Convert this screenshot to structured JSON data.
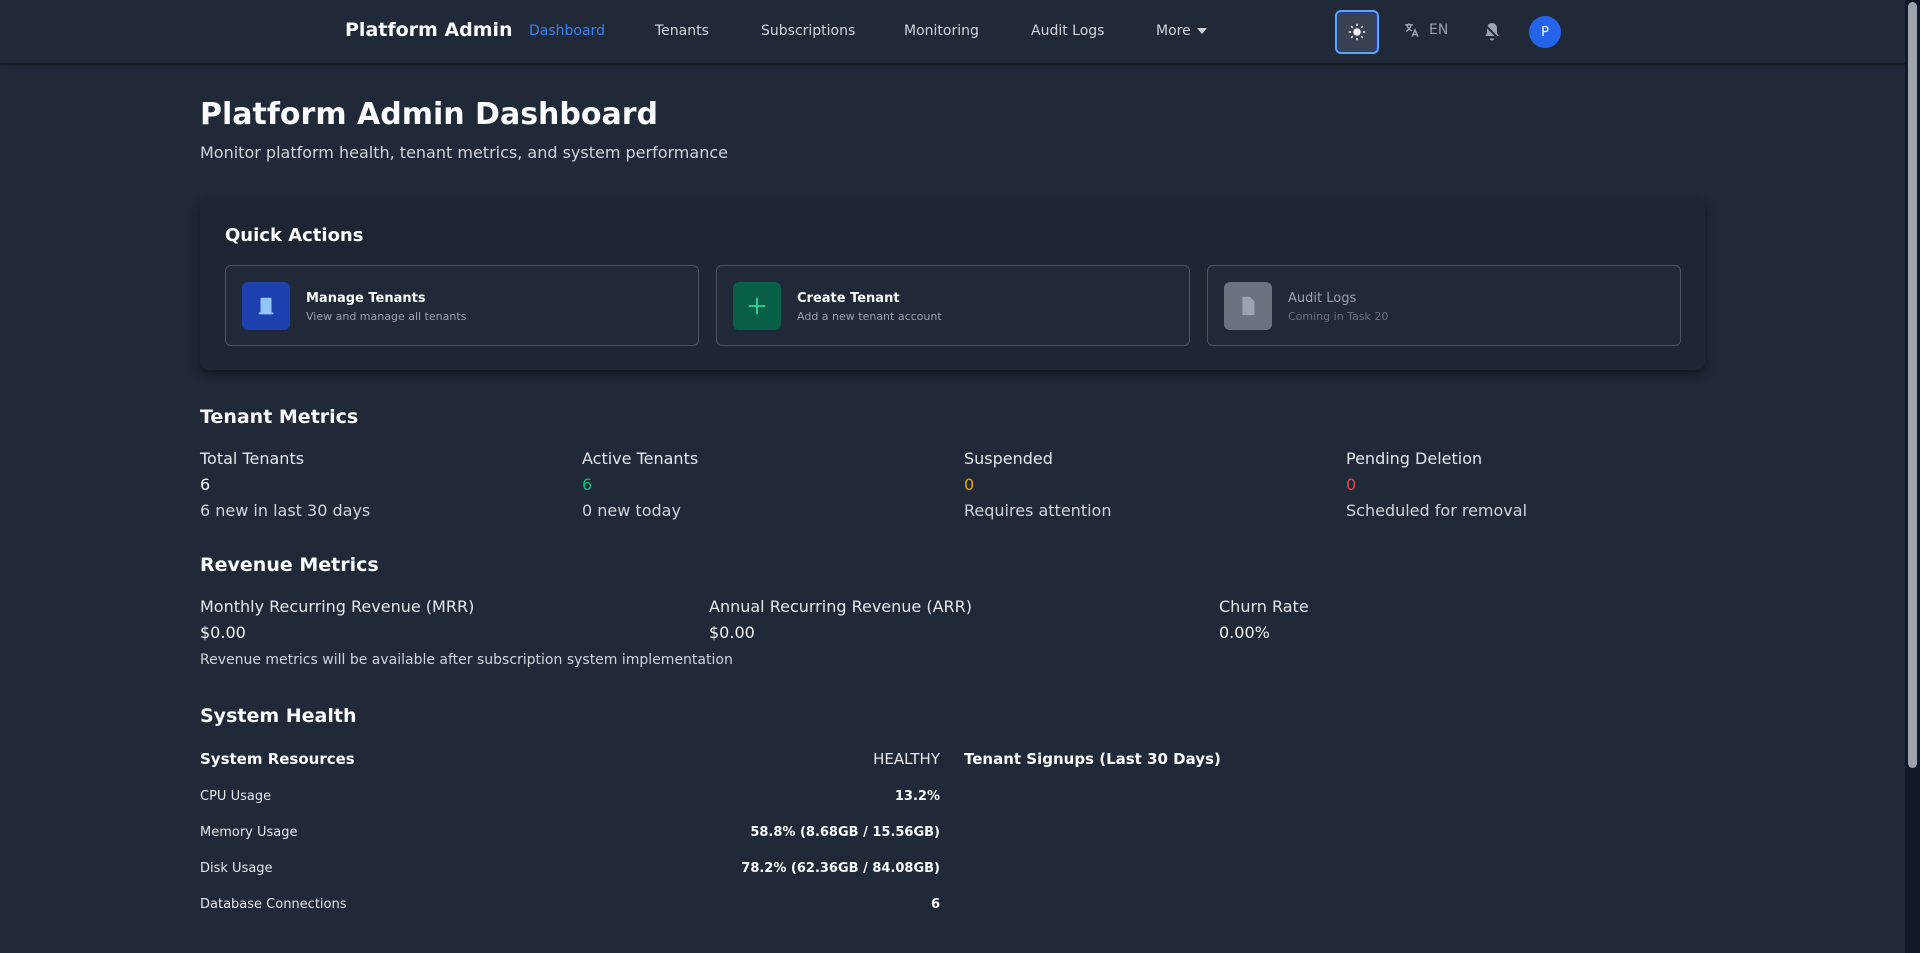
{
  "nav": {
    "brand": "Platform Admin",
    "links": [
      "Dashboard",
      "Tenants",
      "Subscriptions",
      "Monitoring",
      "Audit Logs"
    ],
    "more_label": "More",
    "lang_label": "EN",
    "avatar_initial": "P",
    "active_color": "#3b82f6"
  },
  "header": {
    "title": "Platform Admin Dashboard",
    "subtitle": "Monitor platform health, tenant metrics, and system performance"
  },
  "quick_actions": {
    "title": "Quick Actions",
    "cards": [
      {
        "name": "Manage Tenants",
        "desc": "View and manage all tenants",
        "icon": "building-icon",
        "color": "#1e40af"
      },
      {
        "name": "Create Tenant",
        "desc": "Add a new tenant account",
        "icon": "plus-icon",
        "color": "#065f46"
      },
      {
        "name": "Audit Logs",
        "desc": "Coming in Task 20",
        "icon": "document-icon",
        "color": "#6b7280"
      }
    ]
  },
  "tenant_metrics": {
    "title": "Tenant Metrics",
    "items": [
      {
        "label": "Total Tenants",
        "value": "6",
        "sub": "6 new in last 30 days",
        "color": "#f9fafb"
      },
      {
        "label": "Active Tenants",
        "value": "6",
        "sub": "0 new today",
        "color": "#10b981"
      },
      {
        "label": "Suspended",
        "value": "0",
        "sub": "Requires attention",
        "color": "#f59e0b"
      },
      {
        "label": "Pending Deletion",
        "value": "0",
        "sub": "Scheduled for removal",
        "color": "#ef4444"
      }
    ]
  },
  "revenue_metrics": {
    "title": "Revenue Metrics",
    "items": [
      {
        "label": "Monthly Recurring Revenue (MRR)",
        "value": "$0.00"
      },
      {
        "label": "Annual Recurring Revenue (ARR)",
        "value": "$0.00"
      },
      {
        "label": "Churn Rate",
        "value": "0.00%"
      }
    ],
    "note": "Revenue metrics will be available after subscription system implementation"
  },
  "system_health": {
    "title": "System Health",
    "resources_title": "System Resources",
    "status": "HEALTHY",
    "rows": [
      {
        "label": "CPU Usage",
        "value": "13.2%"
      },
      {
        "label": "Memory Usage",
        "value": "58.8% (8.68GB / 15.56GB)"
      },
      {
        "label": "Disk Usage",
        "value": "78.2% (62.36GB / 84.08GB)"
      },
      {
        "label": "Database Connections",
        "value": "6"
      }
    ],
    "signups_title": "Tenant Signups (Last 30 Days)"
  }
}
